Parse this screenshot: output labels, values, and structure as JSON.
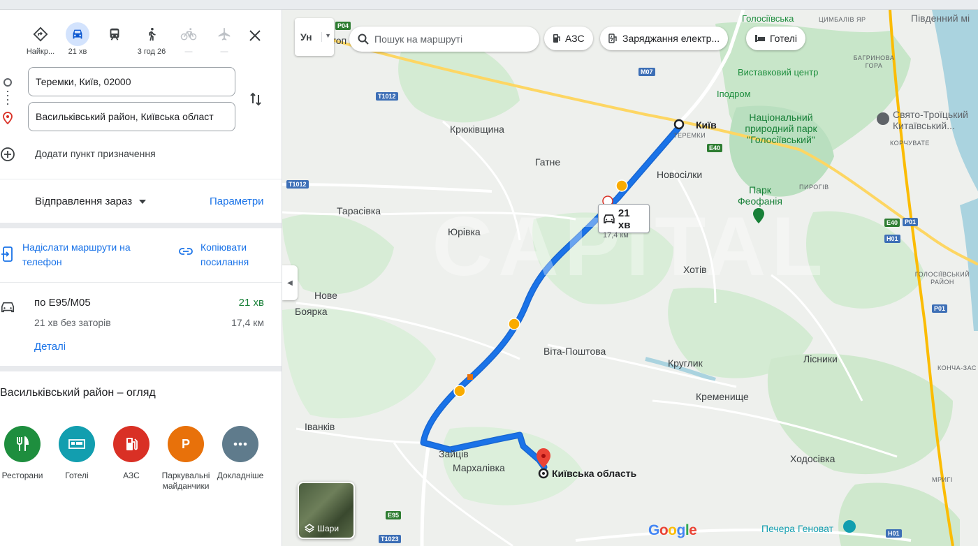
{
  "travel_modes": [
    {
      "name": "best",
      "label": "Найкр..."
    },
    {
      "name": "car",
      "label": "21 хв"
    },
    {
      "name": "transit",
      "label": ""
    },
    {
      "name": "walk",
      "label": "3 год 26"
    },
    {
      "name": "bike",
      "label": "—"
    },
    {
      "name": "flight",
      "label": "—"
    }
  ],
  "route": {
    "origin": "Теремки, Київ, 02000",
    "destination": "Васильківський район, Київська област",
    "add_destination": "Додати пункт призначення"
  },
  "depart": {
    "label": "Відправлення зараз",
    "params": "Параметри"
  },
  "share": {
    "send_label": "Надіслати маршрути на телефон",
    "copy_label": "Копіювати посилання"
  },
  "route_option": {
    "name": "по E95/M05",
    "time": "21 хв",
    "traffic": "21 хв без заторів",
    "distance": "17,4 км",
    "details": "Деталі"
  },
  "overview": {
    "title": "Васильківський район – огляд",
    "categories": [
      {
        "label": "Ресторани",
        "color": "#1e8e3e",
        "icon": "restaurant-icon"
      },
      {
        "label": "Готелі",
        "color": "#129eaf",
        "icon": "hotel-icon"
      },
      {
        "label": "АЗС",
        "color": "#d93025",
        "icon": "gas-station-icon"
      },
      {
        "label": "Паркувальні майданчики",
        "color": "#e8710a",
        "icon": "parking-icon"
      },
      {
        "label": "Докладніше",
        "color": "#5f7b8c",
        "icon": "more-icon"
      }
    ]
  },
  "map": {
    "lang_label": "Ун",
    "search_placeholder": "Пошук на маршруті",
    "chips": [
      "АЗС",
      "Заряджання електр...",
      "Готелі"
    ],
    "bubble_time": "21 хв",
    "bubble_distance": "17,4 км",
    "layers_label": "Шари",
    "google": "Google",
    "watermark": "CAPITAL",
    "places": {
      "kyiv": "Київ",
      "teremky": "ТЕРЕМКИ",
      "dest": "Київська область",
      "kriukivshchyna": "Крюківщина",
      "hatne": "Гатне",
      "novosilky": "Новосілки",
      "tarasivka": "Тарасівка",
      "yurivka": "Юрівка",
      "khotiv": "Хотів",
      "nove": "Нове",
      "boiarka": "Боярка",
      "vita": "Віта-Поштова",
      "kruhlyk": "Круглик",
      "lisnyky": "Лісники",
      "kremenyshche": "Кременище",
      "ivankiv": "Іванків",
      "zaitsiv": "Зайців",
      "markhalivka": "Мархалівка",
      "khodosivka": "Ходосівка",
      "holosiivska": "Голосіївська",
      "tsymbaliv": "ЦИМБАЛІВ ЯР",
      "pivdennyi": "Південний мі",
      "bahrynova": "БАГРИНОВА ГОРА",
      "vystavkovyi": "Виставковий центр",
      "ipodrom": "Іподром",
      "natspark": "Національний природний парк \"Голосіївський\"",
      "sviato": "Свято-Троїцький Китаївський...",
      "koruvate": "КОРЧУВАТЕ",
      "pyrohiv": "ПИРОГІВ",
      "feofaniia": "Парк Феофанія",
      "holos_raion": "ГОЛОСІЇВСЬКИЙ РАЙОН",
      "koncha": "КОНЧА-ЗАС",
      "mryhy": "МРИГІ",
      "pechera": "Печера Геноват",
      "hop": "гоп"
    },
    "roads": [
      "P04",
      "M07",
      "T1012",
      "T1012",
      "E40",
      "E40",
      "P01",
      "H01",
      "P01",
      "E95",
      "T1023",
      "H01"
    ]
  }
}
